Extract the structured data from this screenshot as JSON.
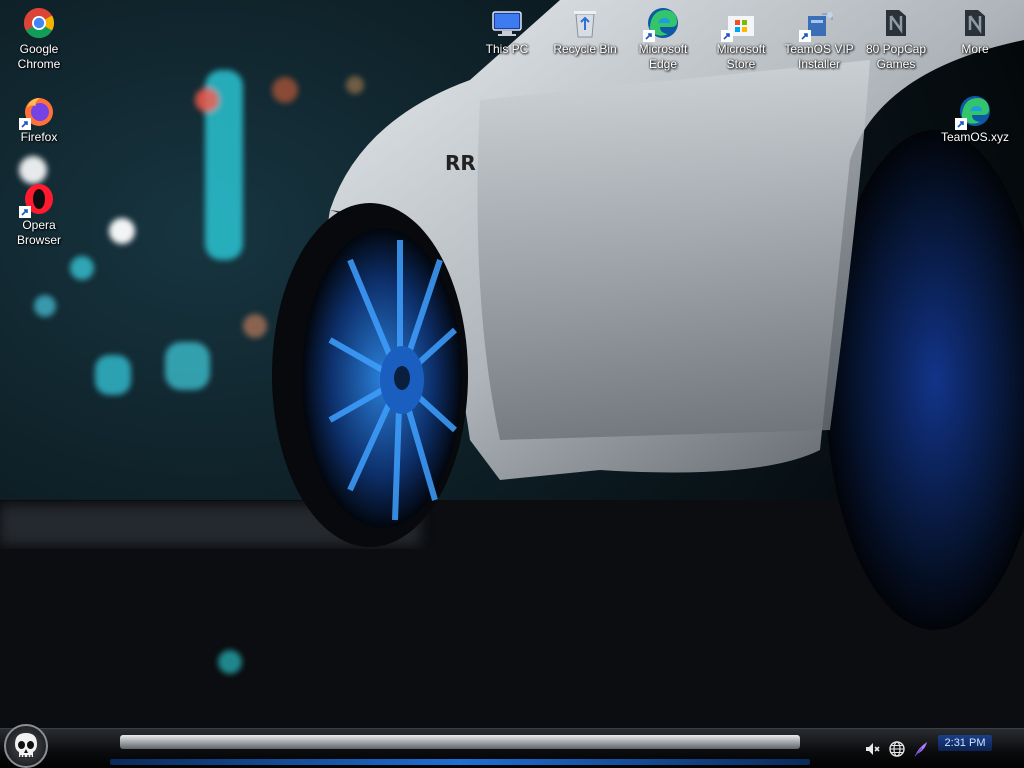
{
  "desktop": {
    "wallpaper": "night street with white sports car and blue alloy wheel",
    "icons_left": [
      {
        "label": "Google\nChrome",
        "icon": "chrome-icon"
      },
      {
        "label": "Firefox",
        "icon": "firefox-icon"
      },
      {
        "label": "Opera\nBrowser",
        "icon": "opera-icon"
      }
    ],
    "icons_top": [
      {
        "label": "This PC",
        "icon": "computer-icon"
      },
      {
        "label": "Recycle Bin",
        "icon": "recycle-bin-icon"
      },
      {
        "label": "Microsoft\nEdge",
        "icon": "edge-icon"
      },
      {
        "label": "Microsoft\nStore",
        "icon": "store-icon"
      },
      {
        "label": "TeamOS VIP\nInstaller",
        "icon": "installer-icon"
      },
      {
        "label": "80 PopCap\nGames",
        "icon": "folder-icon"
      },
      {
        "label": "More",
        "icon": "folder-icon"
      }
    ],
    "icons_right": [
      {
        "label": "TeamOS.xyz",
        "icon": "edge-icon"
      }
    ]
  },
  "taskbar": {
    "start_icon": "skull-start-icon",
    "tray_icons": [
      "speaker-muted-icon",
      "network-globe-icon",
      "feather-pen-icon"
    ],
    "clock": "2:31 PM"
  },
  "colors": {
    "accent_blue": "#1f6fd6",
    "clock_bg": "#1b3f8a",
    "label_text": "#ffffff"
  }
}
